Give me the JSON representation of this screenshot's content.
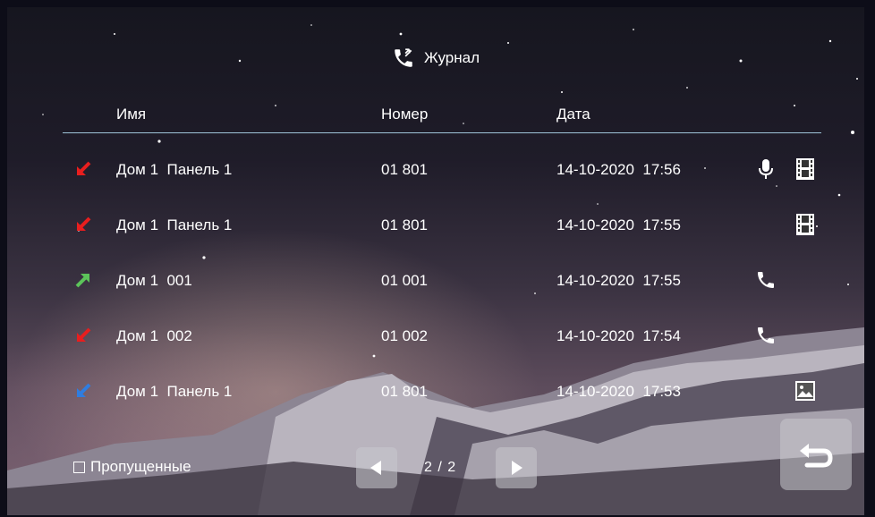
{
  "title": "Журнал",
  "columns": {
    "name": "Имя",
    "number": "Номер",
    "date": "Дата"
  },
  "rows": [
    {
      "direction": "incoming-missed",
      "arrow_color": "#e81e1e",
      "name": "Дом 1  Панель 1",
      "number": "01 801",
      "date": "14-10-2020  17:56",
      "media": [
        "microphone-icon",
        "film-icon"
      ]
    },
    {
      "direction": "incoming-missed",
      "arrow_color": "#e81e1e",
      "name": "Дом 1  Панель 1",
      "number": "01 801",
      "date": "14-10-2020  17:55",
      "media": [
        "film-icon"
      ]
    },
    {
      "direction": "outgoing",
      "arrow_color": "#5cc45a",
      "name": "Дом 1  001",
      "number": "01 001",
      "date": "14-10-2020  17:55",
      "media": [
        "phone-icon"
      ]
    },
    {
      "direction": "incoming-missed",
      "arrow_color": "#e81e1e",
      "name": "Дом 1  002",
      "number": "01 002",
      "date": "14-10-2020  17:54",
      "media": [
        "phone-icon"
      ]
    },
    {
      "direction": "incoming-answered",
      "arrow_color": "#2f7de0",
      "name": "Дом 1  Панель 1",
      "number": "01 801",
      "date": "14-10-2020  17:53",
      "media": [
        "image-icon"
      ]
    }
  ],
  "filter": {
    "label": "Пропущенные",
    "checked": false
  },
  "pagination": {
    "text": "2 / 2"
  },
  "buttons": {
    "prev": "prev-arrow-icon",
    "next": "next-arrow-icon",
    "back": "back-arrow-icon"
  }
}
